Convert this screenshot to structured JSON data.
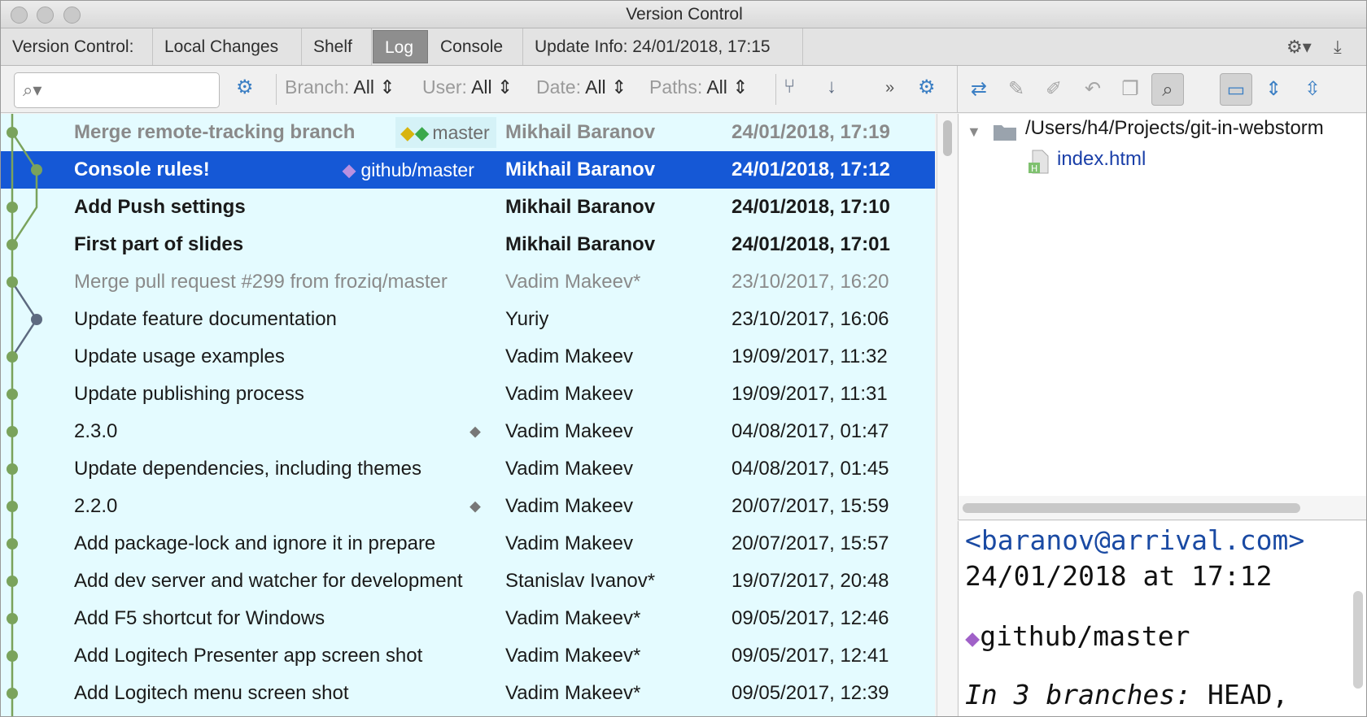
{
  "window": {
    "title": "Version Control"
  },
  "tabs": {
    "label": "Version Control:",
    "items": [
      "Local Changes",
      "Shelf",
      "Log",
      "Console",
      "Update Info: 24/01/2018, 17:15"
    ],
    "active": "Log"
  },
  "toolbar": {
    "search_value": "",
    "filters": [
      {
        "name": "Branch:",
        "value": "All"
      },
      {
        "name": "User:",
        "value": "All"
      },
      {
        "name": "Date:",
        "value": "All"
      },
      {
        "name": "Paths:",
        "value": "All"
      }
    ],
    "more_label": "»"
  },
  "log": {
    "rows": [
      {
        "subject": "Merge remote-tracking branch",
        "ref": "master",
        "author": "Mikhail Baranov",
        "date": "24/01/2018, 17:19"
      },
      {
        "subject": "Console rules!",
        "ref": "github/master",
        "author": "Mikhail Baranov",
        "date": "24/01/2018, 17:12"
      },
      {
        "subject": "Add Push settings",
        "author": "Mikhail Baranov",
        "date": "24/01/2018, 17:10"
      },
      {
        "subject": "First part of slides",
        "author": "Mikhail Baranov",
        "date": "24/01/2018, 17:01"
      },
      {
        "subject": "Merge pull request #299 from froziq/master",
        "author": "Vadim Makeev*",
        "date": "23/10/2017, 16:20"
      },
      {
        "subject": "Update feature documentation",
        "author": "Yuriy",
        "date": "23/10/2017, 16:06"
      },
      {
        "subject": "Update usage examples",
        "author": "Vadim Makeev",
        "date": "19/09/2017, 11:32"
      },
      {
        "subject": "Update publishing process",
        "author": "Vadim Makeev",
        "date": "19/09/2017, 11:31"
      },
      {
        "subject": "2.3.0",
        "author": "Vadim Makeev",
        "date": "04/08/2017, 01:47"
      },
      {
        "subject": "Update dependencies, including themes",
        "author": "Vadim Makeev",
        "date": "04/08/2017, 01:45"
      },
      {
        "subject": "2.2.0",
        "author": "Vadim Makeev",
        "date": "20/07/2017, 15:59"
      },
      {
        "subject": "Add package-lock and ignore it in prepare",
        "author": "Vadim Makeev",
        "date": "20/07/2017, 15:57"
      },
      {
        "subject": "Add dev server and watcher for development",
        "author": "Stanislav Ivanov*",
        "date": "19/07/2017, 20:48"
      },
      {
        "subject": "Add F5 shortcut for Windows",
        "author": "Vadim Makeev*",
        "date": "09/05/2017, 12:46"
      },
      {
        "subject": "Add Logitech Presenter app screen shot",
        "author": "Vadim Makeev*",
        "date": "09/05/2017, 12:41"
      },
      {
        "subject": "Add Logitech menu screen shot",
        "author": "Vadim Makeev*",
        "date": "09/05/2017, 12:39"
      }
    ]
  },
  "tree": {
    "root_path": "/Users/h4/Projects/git-in-webstorm",
    "files": [
      "index.html"
    ]
  },
  "details": {
    "email": "<baranov@arrival.com>",
    "datetime": "24/01/2018 at 17:12",
    "ref": "github/master",
    "branches_label": "In 3 branches:",
    "branches_value": "HEAD,"
  },
  "colors": {
    "accent": "#3b7fc4",
    "selection": "#1558d6",
    "log_background": "#e4fbff",
    "graph_line": "#7aa35c",
    "graph_node_alt": "#5d6a80",
    "tag": "#a061c8"
  }
}
